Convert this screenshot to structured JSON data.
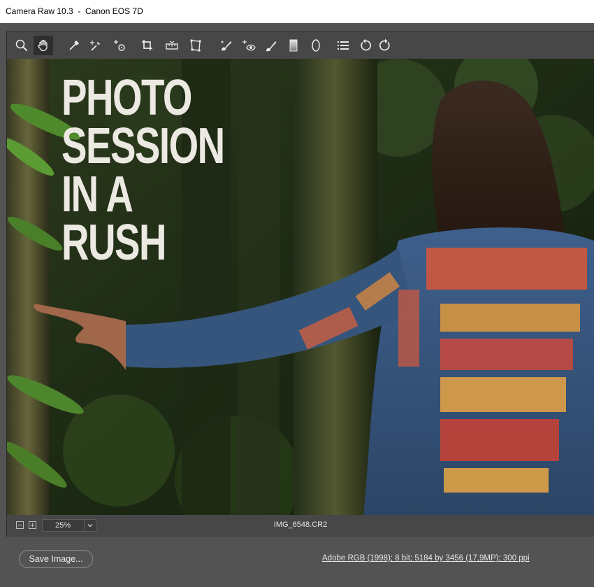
{
  "window": {
    "title": "Camera Raw 10.3  -  Canon EOS 7D"
  },
  "toolbar": {
    "tools": [
      {
        "name": "zoom-tool",
        "icon": "magnifier-icon"
      },
      {
        "name": "hand-tool",
        "icon": "hand-icon",
        "active": true
      },
      {
        "name": "white-balance-tool",
        "icon": "eyedropper-icon"
      },
      {
        "name": "color-sampler-tool",
        "icon": "sampler-icon"
      },
      {
        "name": "targeted-adjustment-tool",
        "icon": "target-adjust-icon"
      },
      {
        "name": "crop-tool",
        "icon": "crop-icon"
      },
      {
        "name": "straighten-tool",
        "icon": "level-icon"
      },
      {
        "name": "transform-tool",
        "icon": "transform-icon"
      },
      {
        "name": "spot-removal-tool",
        "icon": "brush-heal-icon"
      },
      {
        "name": "red-eye-removal-tool",
        "icon": "red-eye-icon"
      },
      {
        "name": "adjustment-brush-tool",
        "icon": "brush-icon"
      },
      {
        "name": "graduated-filter-tool",
        "icon": "gradient-icon"
      },
      {
        "name": "radial-filter-tool",
        "icon": "ellipse-icon"
      },
      {
        "name": "preferences-button",
        "icon": "list-icon"
      },
      {
        "name": "rotate-left-button",
        "icon": "rotate-ccw-icon"
      },
      {
        "name": "rotate-right-button",
        "icon": "rotate-cw-icon"
      }
    ]
  },
  "preview": {
    "headline_lines": [
      "PHOTO",
      "SESSION",
      "IN A",
      "RUSH"
    ],
    "headline_color": "#ece9e3"
  },
  "status": {
    "zoom_out_label": "−",
    "zoom_in_label": "+",
    "zoom_value": "25%",
    "filename": "IMG_6548.CR2"
  },
  "footer": {
    "save_label": "Save Image...",
    "workflow_info": "Adobe RGB (1998); 8 bit; 5184 by 3456 (17,9MP); 300 ppi"
  },
  "colors": {
    "panel": "#474747",
    "background": "#535353",
    "active_tool": "#2e2e2e"
  }
}
